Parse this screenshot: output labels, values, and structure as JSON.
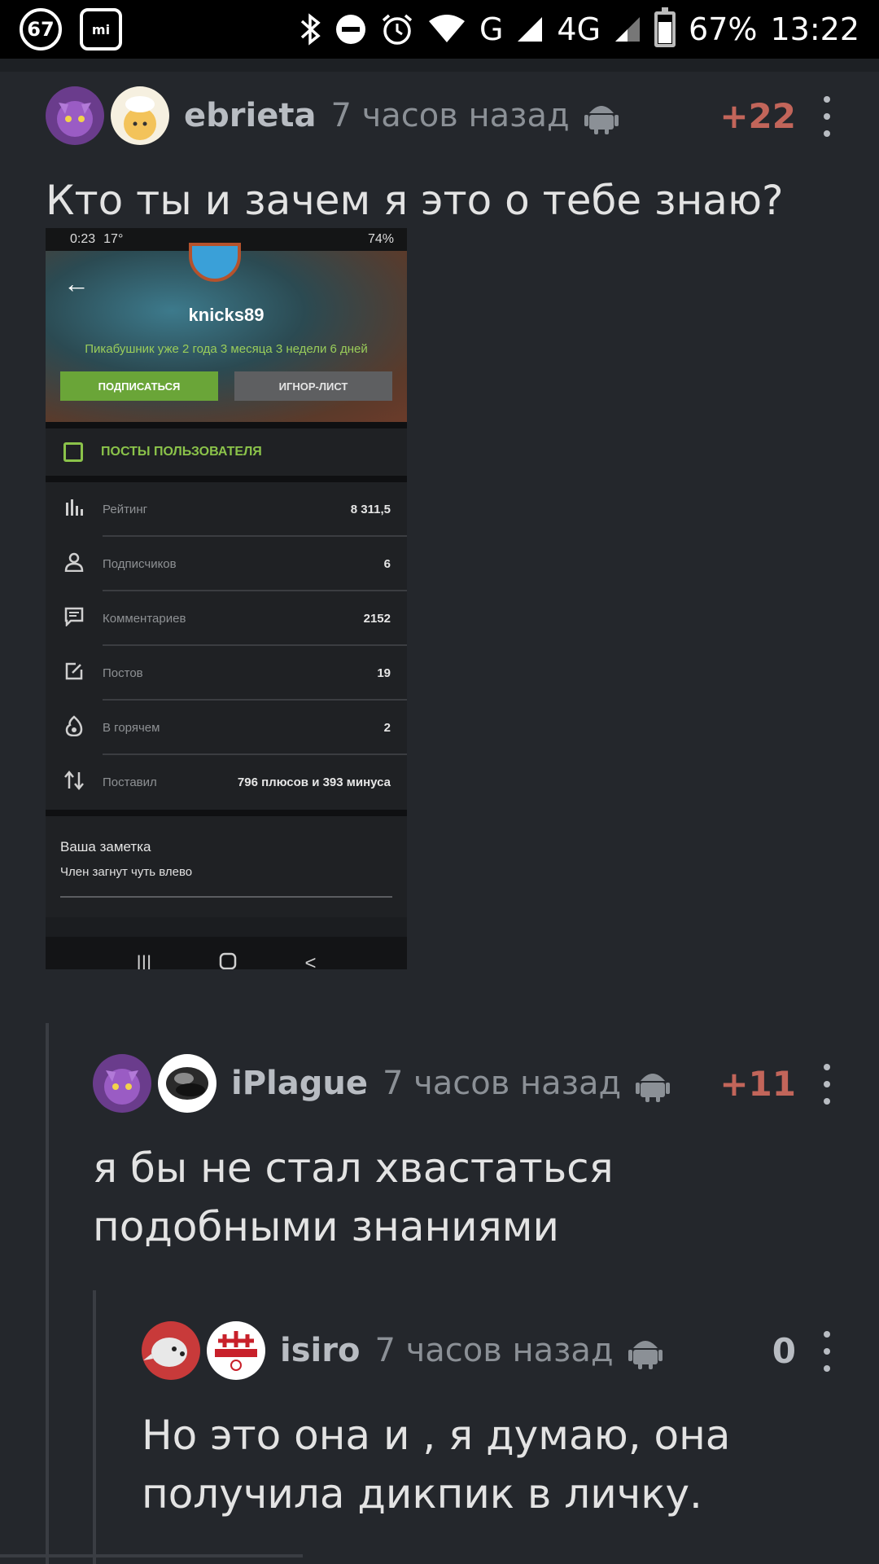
{
  "status_bar": {
    "notif_count": "67",
    "mi_label": "mi",
    "network_g": "G",
    "network_4g": "4G",
    "battery": "67%",
    "time": "13:22"
  },
  "comments": [
    {
      "user": "ebrieta",
      "time": "7 часов назад",
      "score": "+22",
      "text": "Кто ты и зачем я это о тебе знаю?"
    },
    {
      "user": "iPlague",
      "time": "7 часов назад",
      "score": "+11",
      "text": "я бы не стал хвастаться подобными знаниями"
    },
    {
      "user": "isiro",
      "time": "7 часов назад",
      "score": "0",
      "text": "Но это она и , я думаю, она получила дикпик в личку."
    }
  ],
  "screenshot": {
    "status_time": "0:23",
    "status_temp": "17°",
    "status_battery": "74%",
    "username": "knicks89",
    "tenure": "Пикабушник уже 2 года 3 месяца 3 недели 6 дней",
    "subscribe": "ПОДПИСАТЬСЯ",
    "ignore": "ИГНОР-ЛИСТ",
    "posts_link": "ПОСТЫ ПОЛЬЗОВАТЕЛЯ",
    "stats": [
      {
        "icon": "rating-icon",
        "label": "Рейтинг",
        "value": "8 311,5"
      },
      {
        "icon": "person-icon",
        "label": "Подписчиков",
        "value": "6"
      },
      {
        "icon": "comment-icon",
        "label": "Комментариев",
        "value": "2152"
      },
      {
        "icon": "edit-icon",
        "label": "Постов",
        "value": "19"
      },
      {
        "icon": "fire-icon",
        "label": "В горячем",
        "value": "2"
      },
      {
        "icon": "updown-icon",
        "label": "Поставил",
        "value": "796 плюсов и 393 минуса"
      }
    ],
    "note_title": "Ваша заметка",
    "note_value": "Член загнут чуть влево"
  }
}
